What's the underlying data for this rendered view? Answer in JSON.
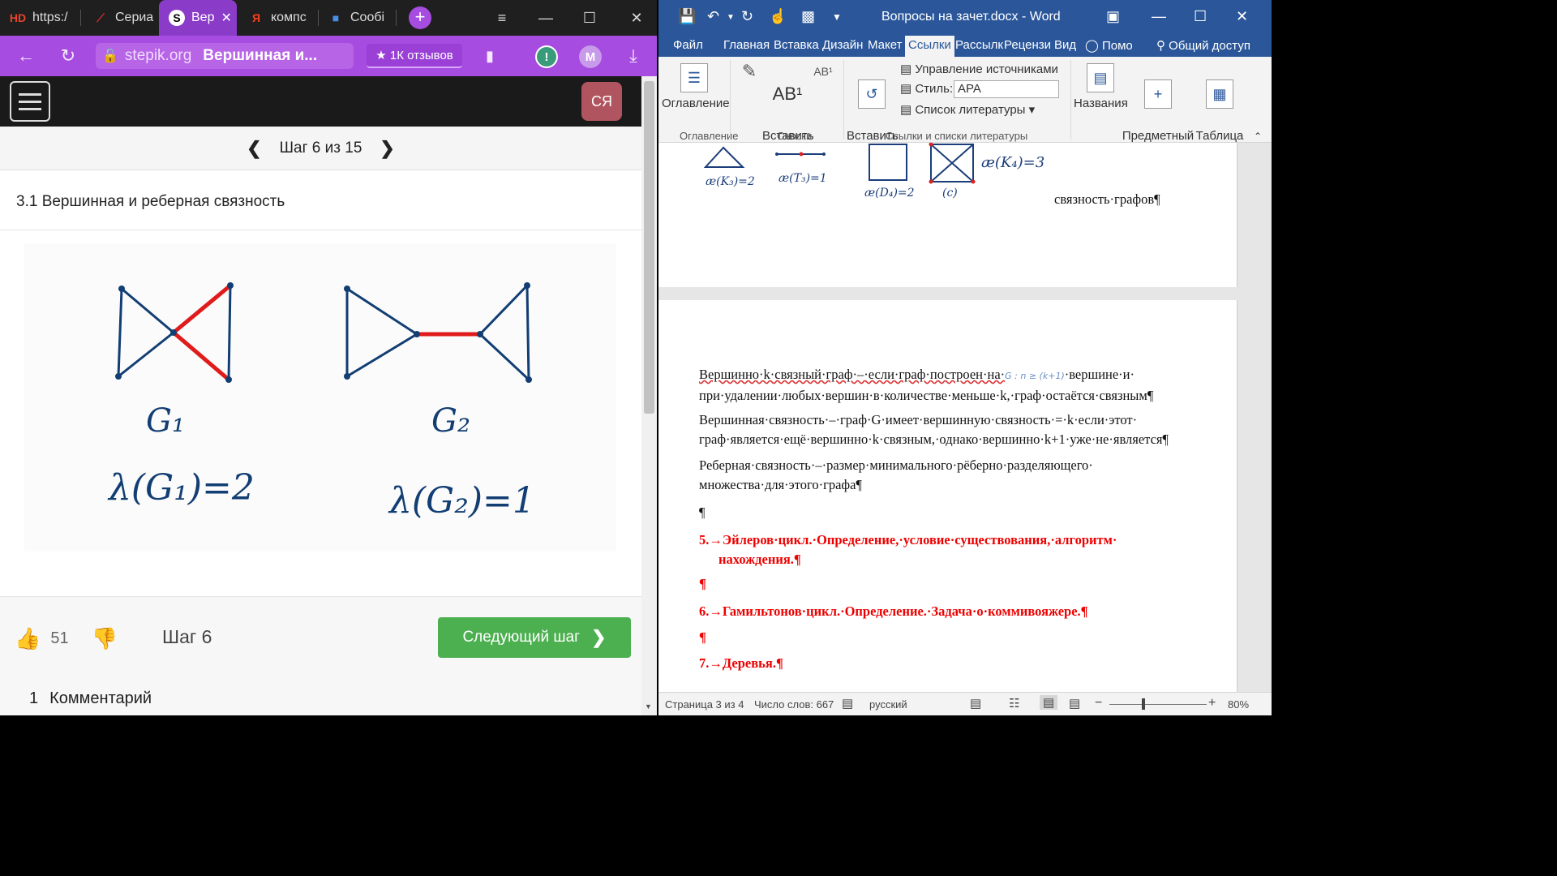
{
  "browser": {
    "tabs": [
      {
        "label": "https:/",
        "fav": "HD",
        "fav_color": "#e8442a"
      },
      {
        "label": "Сериа",
        "fav": "⟋",
        "fav_color": "#d62b2b"
      },
      {
        "label": "Вер",
        "fav": "S",
        "fav_color": "#ffffff"
      },
      {
        "label": "компс",
        "fav": "Я",
        "fav_color": "#fc3f1d"
      },
      {
        "label": "Сообі",
        "fav": "■",
        "fav_color": "#4a8fe7"
      }
    ],
    "new_tab_label": "+",
    "tab_close": "✕",
    "window_controls": {
      "menu": "≡",
      "minimize": "—",
      "maximize": "☐",
      "close": "✕"
    },
    "address": {
      "back": "←",
      "reload": "↻",
      "domain": "stepik.org",
      "page_title": "Вершинная и...",
      "reviews": "★ 1К отзывов",
      "bookmark": "▮",
      "ext_badge": "!",
      "profile_letter": "M",
      "download": "⤓"
    },
    "accent": "#a64ce0"
  },
  "stepik": {
    "avatar": "СЯ",
    "step_prev": "❮",
    "step_indicator": "Шаг 6 из 15",
    "step_next": "❯",
    "lesson_title": "3.1 Вершинная и реберная связность",
    "figure": {
      "g1_label": "G₁",
      "g1_formula": "λ(G₁)=2",
      "g2_label": "G₂",
      "g2_formula": "λ(G₂)=1"
    },
    "like_count": "51",
    "step_footer": "Шаг 6",
    "next_button": "Следующий шаг",
    "next_arrow": "❯",
    "comments_count": "1",
    "comments_label": "Комментарий"
  },
  "word": {
    "window_title": "Вопросы на зачет.docx - Word",
    "menu": [
      "Файл",
      "Главная",
      "Вставка",
      "Дизайн",
      "Макет",
      "Ссылки",
      "Рассылк",
      "Рецензи",
      "Вид",
      "Помо",
      "Общий доступ"
    ],
    "active_menu": "Ссылки",
    "ribbon": {
      "toc": "Оглавление",
      "insert_footnote": "Вставить\nсноску",
      "insert_citation": "Вставить\nссылку",
      "manage_sources": "Управление источниками",
      "style_label": "Стиль:",
      "style_value": "APA",
      "bibliography": "Список литературы",
      "captions": "Названия",
      "index": "Предметный\nуказатель",
      "table_authorities": "Таблица\nссылок",
      "group_toc": "Оглавление",
      "group_footnotes": "Сноски",
      "group_citations": "Ссылки и списки литературы"
    },
    "page1": {
      "sketch_labels": [
        "æ(K₃)=2",
        "æ(T₃)=1",
        "æ(D₄)=2",
        "(c)",
        "æ(K₄)=3"
      ],
      "tail_text": "связность·графов¶"
    },
    "page2": {
      "p1a": "Вершинно·k·связный·граф·–·если·граф·построен·на·",
      "p1_handwrite": "G : n ≥ (k+1)",
      "p1b": "·вершине·и·",
      "p1c": "при·удалении·любых·вершин·в·количестве·меньше·k,·граф·остаётся·связным¶",
      "p2a": "Вершинная·связность·–·граф·G·имеет·вершинную·связность·=·k·если·этот·",
      "p2b": "граф·является·ещё·вершинно·k·связным,·однако·вершинно·k+1·уже·не·является¶",
      "p3a": "Реберная·связность·–·размер·минимального·рёберно·разделяющего·",
      "p3b": "множества·для·этого·графа¶",
      "empty1": "¶",
      "h5a": "5.→Эйлеров·цикл.·Определение,·условие·существования,·алгоритм·",
      "h5b": "нахождения.¶",
      "empty2": "¶",
      "h6": "6.→Гамильтонов·цикл.·Определение.·Задача·о·коммивояжере.¶",
      "empty3": "¶",
      "h7": "7.→Деревья.¶"
    },
    "status": {
      "page": "Страница 3 из 4",
      "words": "Число слов: 667",
      "language": "русский",
      "zoom": "80%",
      "minus": "−",
      "plus": "+"
    },
    "accent": "#2b579a"
  }
}
